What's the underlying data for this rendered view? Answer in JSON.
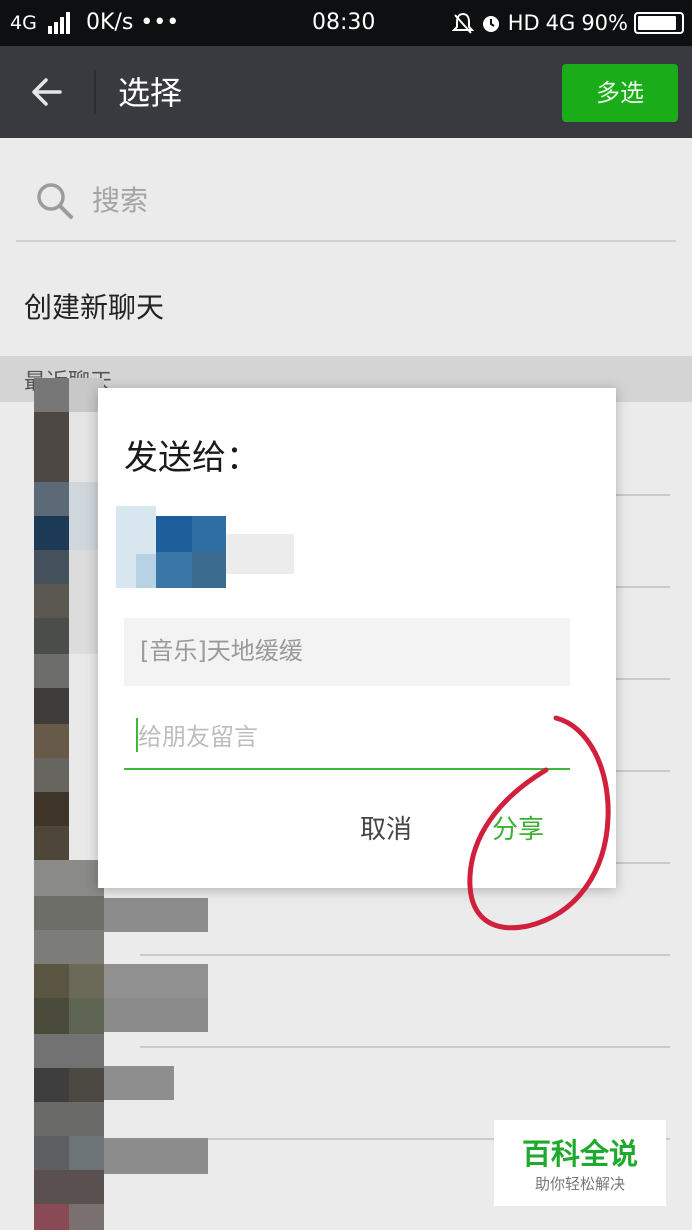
{
  "status_bar": {
    "network": "4G",
    "speed": "0K/s •••",
    "time": "08:30",
    "hd": "HD",
    "network_right": "4G",
    "battery": "90%"
  },
  "titlebar": {
    "title": "选择",
    "multi_select_label": "多选"
  },
  "background": {
    "search_placeholder": "搜索",
    "new_chat_label": "创建新聊天",
    "section_label": "最近聊天"
  },
  "dialog": {
    "title": "发送给：",
    "preview_text": "[音乐]天地缓缓",
    "message_placeholder": "给朋友留言",
    "cancel_label": "取消",
    "share_label": "分享"
  },
  "watermark": {
    "main": "百科全说",
    "sub": "助你轻松解决"
  },
  "colors": {
    "accent_green": "#1aad19",
    "titlebar": "#393a3f",
    "annotation_red": "#d0203c"
  },
  "icons": [
    "back-arrow-icon",
    "search-icon",
    "signal-icon",
    "alarm-icon",
    "mute-icon",
    "battery-icon"
  ]
}
